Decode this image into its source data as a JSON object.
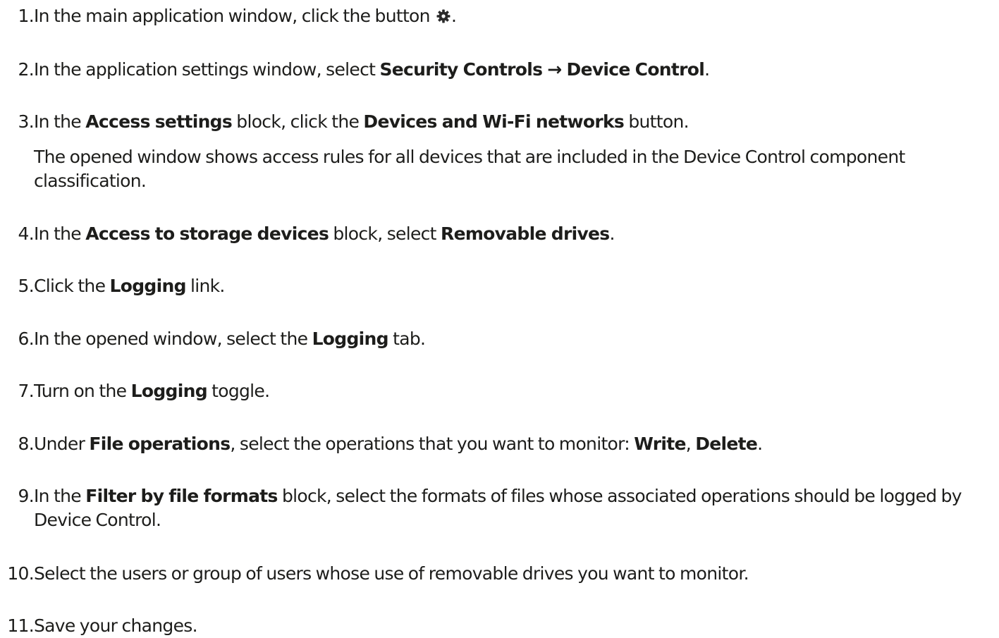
{
  "steps": [
    {
      "number": "1.",
      "parts": [
        "In the main application window, click the button ",
        "."
      ],
      "icon": "gear-icon"
    },
    {
      "number": "2.",
      "parts": [
        "In the application settings window, select ",
        "Security Controls",
        " → ",
        "Device Control",
        "."
      ]
    },
    {
      "number": "3.",
      "parts": [
        "In the ",
        "Access settings",
        " block, click the ",
        "Devices and Wi-Fi networks",
        " button."
      ],
      "note_line1": "The opened window shows access rules for all devices that are included in the Device Control component",
      "note_line2": "classification."
    },
    {
      "number": "4.",
      "parts": [
        "In the ",
        "Access to storage devices",
        " block, select ",
        "Removable drives",
        "."
      ]
    },
    {
      "number": "5.",
      "parts": [
        "Click the ",
        "Logging",
        " link."
      ]
    },
    {
      "number": "6.",
      "parts": [
        "In the opened window, select the ",
        "Logging",
        " tab."
      ]
    },
    {
      "number": "7.",
      "parts": [
        "Turn on the ",
        "Logging",
        " toggle."
      ]
    },
    {
      "number": "8.",
      "parts": [
        "Under ",
        "File operations",
        ", select the operations that you want to monitor: ",
        "Write",
        ", ",
        "Delete",
        "."
      ]
    },
    {
      "number": "9.",
      "parts": [
        "In the ",
        "Filter by file formats",
        " block, select the formats of files whose associated operations should be logged by"
      ],
      "line2": "Device Control."
    },
    {
      "number": "10.",
      "parts": [
        "Select the users or group of users whose use of removable drives you want to monitor."
      ]
    },
    {
      "number": "11.",
      "parts": [
        "Save your changes."
      ]
    }
  ]
}
